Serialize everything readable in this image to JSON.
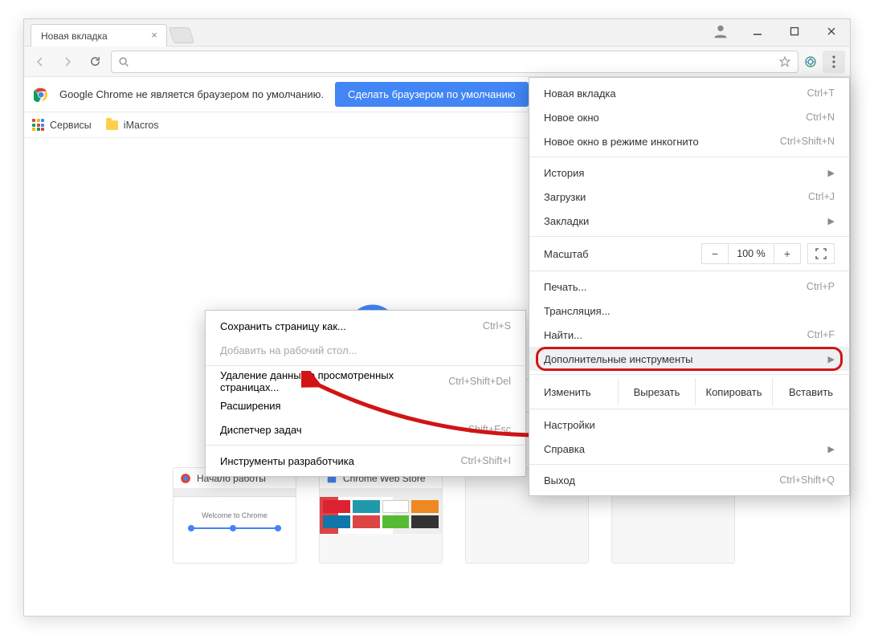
{
  "tab": {
    "title": "Новая вкладка"
  },
  "infobar": {
    "text": "Google Chrome не является браузером по умолчанию.",
    "button": "Сделать браузером по умолчанию"
  },
  "bookmarks": {
    "apps": "Сервисы",
    "items": [
      {
        "label": "iMacros"
      }
    ]
  },
  "zoom": {
    "value": "100 %"
  },
  "menu": {
    "new_tab": "Новая вкладка",
    "new_tab_sc": "Ctrl+T",
    "new_window": "Новое окно",
    "new_window_sc": "Ctrl+N",
    "incognito": "Новое окно в режиме инкогнито",
    "incognito_sc": "Ctrl+Shift+N",
    "history": "История",
    "downloads": "Загрузки",
    "downloads_sc": "Ctrl+J",
    "bookmarks": "Закладки",
    "zoom": "Масштаб",
    "print": "Печать...",
    "print_sc": "Ctrl+P",
    "cast": "Трансляция...",
    "find": "Найти...",
    "find_sc": "Ctrl+F",
    "more_tools": "Дополнительные инструменты",
    "edit": "Изменить",
    "cut": "Вырезать",
    "copy": "Копировать",
    "paste": "Вставить",
    "settings": "Настройки",
    "help": "Справка",
    "exit": "Выход",
    "exit_sc": "Ctrl+Shift+Q"
  },
  "submenu": {
    "save_as": "Сохранить страницу как...",
    "save_as_sc": "Ctrl+S",
    "add_desktop": "Добавить на рабочий стол...",
    "clear_data": "Удаление данных о просмотренных страницах...",
    "clear_data_sc": "Ctrl+Shift+Del",
    "extensions": "Расширения",
    "task_mgr": "Диспетчер задач",
    "task_mgr_sc": "Shift+Esc",
    "devtools": "Инструменты разработчика",
    "devtools_sc": "Ctrl+Shift+I"
  },
  "tiles": {
    "0": {
      "title": "Начало работы"
    },
    "1": {
      "title": "Chrome Web Store"
    }
  },
  "welcome_text": "Welcome to Chrome"
}
